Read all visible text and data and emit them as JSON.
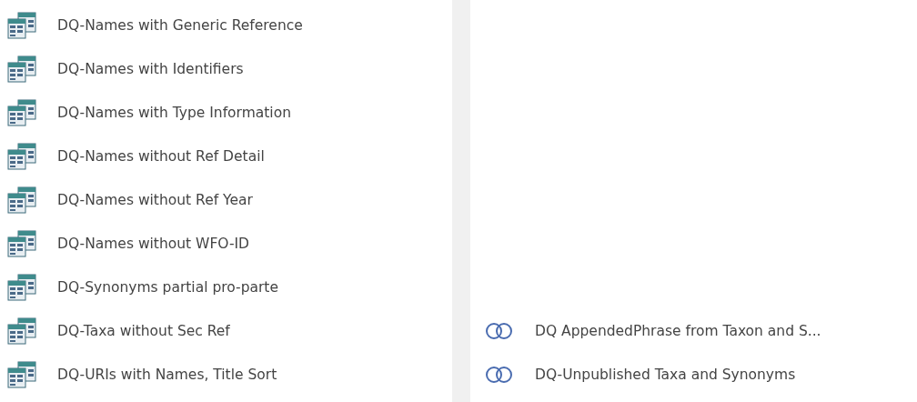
{
  "left_list": {
    "items": [
      {
        "label": "DQ-Names with Generic Reference",
        "kind": "select"
      },
      {
        "label": "DQ-Names with Identifiers",
        "kind": "select"
      },
      {
        "label": "DQ-Names with Type Information",
        "kind": "select"
      },
      {
        "label": "DQ-Names without Ref Detail",
        "kind": "select"
      },
      {
        "label": "DQ-Names without Ref Year",
        "kind": "select"
      },
      {
        "label": "DQ-Names without WFO-ID",
        "kind": "select"
      },
      {
        "label": "DQ-Synonyms partial pro-parte",
        "kind": "select"
      },
      {
        "label": "DQ-Taxa without Sec Ref",
        "kind": "select"
      },
      {
        "label": "DQ-URIs with Names, Title Sort",
        "kind": "select"
      }
    ]
  },
  "right_list": {
    "items": [
      {
        "label": "DQ AppendedPhrase from Taxon and S...",
        "kind": "union"
      },
      {
        "label": "DQ-Unpublished Taxa and Synonyms",
        "kind": "union"
      }
    ]
  }
}
